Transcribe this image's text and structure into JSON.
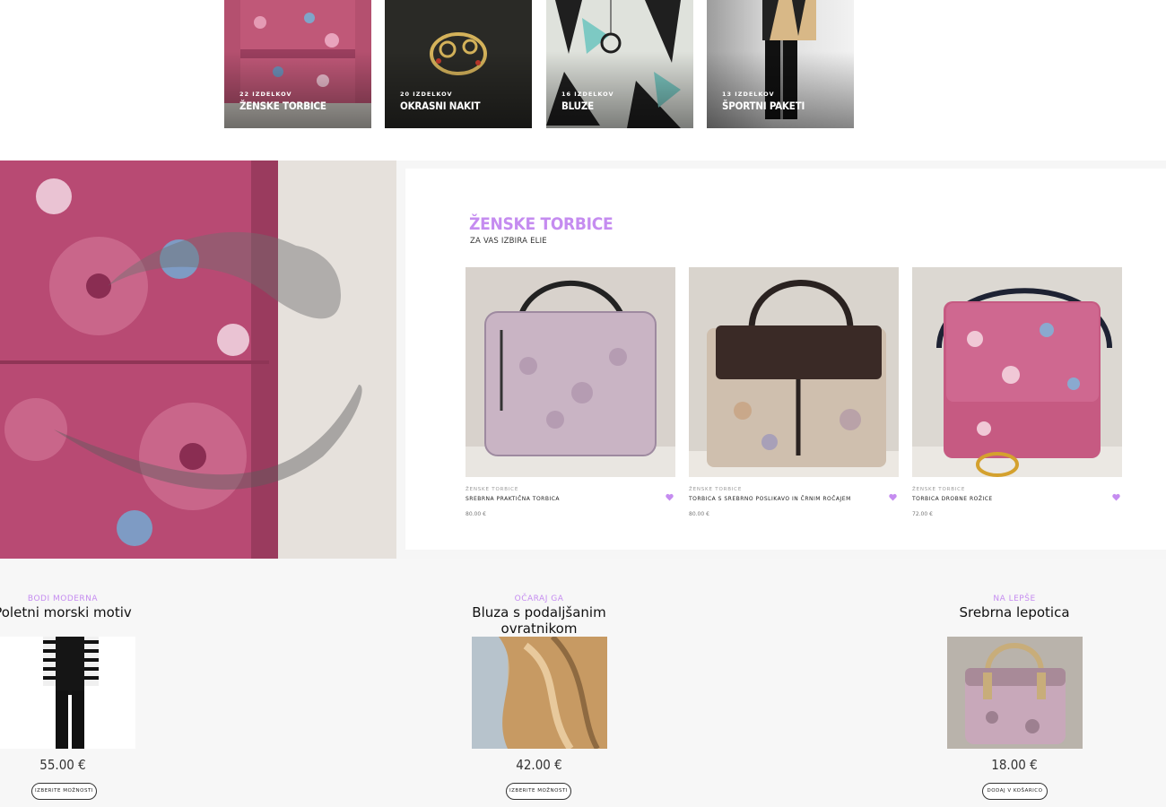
{
  "categories": [
    {
      "count": "22 IZDELKOV",
      "name": "ŽENSKE TORBICE"
    },
    {
      "count": "20 IZDELKOV",
      "name": "OKRASNI NAKIT"
    },
    {
      "count": "16 IZDELKOV",
      "name": "BLUZE"
    },
    {
      "count": "13 IZDELKOV",
      "name": "ŠPORTNI PAKETI"
    }
  ],
  "featured": {
    "title": "ŽENSKE TORBICE",
    "subtitle": "ZA VAS IZBIRA ELIE",
    "products": [
      {
        "category": "ŽENSKE TORBICE",
        "name": "SREBRNA PRAKTIČNA TORBICA",
        "price": "80.00 €"
      },
      {
        "category": "ŽENSKE TORBICE",
        "name": "TORBICA S SREBRNO POSLIKAVO IN ČRNIM ROČAJEM",
        "price": "80.00 €"
      },
      {
        "category": "ŽENSKE TORBICE",
        "name": "TORBICA DROBNE ROŽICE",
        "price": "72.00 €"
      }
    ]
  },
  "highlights": [
    {
      "eyebrow": "BODI MODERNA",
      "title": "Poletni morski motiv",
      "price": "55.00 €",
      "button": "IZBERITE MOŽNOSTI"
    },
    {
      "eyebrow": "OČARAJ GA",
      "title": "Bluza s podaljšanim ovratnikom",
      "price": "42.00 €",
      "button": "IZBERITE MOŽNOSTI"
    },
    {
      "eyebrow": "NA LEPŠE",
      "title": "Srebrna lepotica",
      "price": "18.00 €",
      "button": "DODAJ V KOŠARICO"
    }
  ],
  "colors": {
    "accent": "#c58cf0",
    "band": "#f6f6f6"
  },
  "icons": {
    "wishlist": "heart-icon"
  }
}
